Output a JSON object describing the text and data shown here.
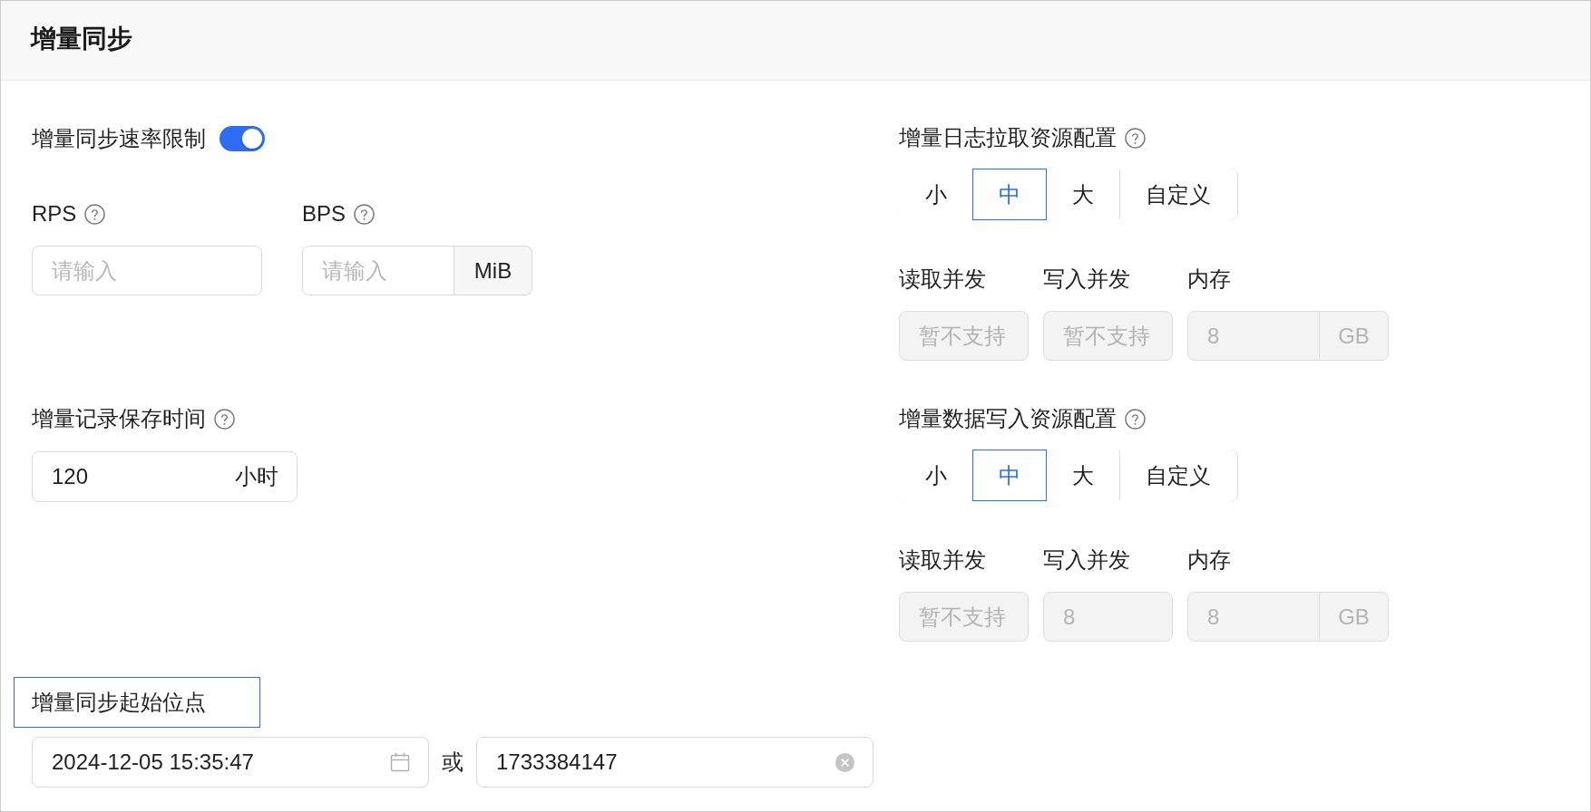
{
  "header": {
    "title": "增量同步"
  },
  "rate_limit": {
    "label": "增量同步速率限制",
    "on": true
  },
  "rate_fields": [
    {
      "label": "RPS",
      "help": true,
      "placeholder": "请输入",
      "disabled": false
    },
    {
      "label": "BPS",
      "help": true,
      "placeholder": "请输入",
      "unit": "MiB",
      "disabled": false
    }
  ],
  "retention": {
    "label": "增量记录保存时间",
    "help": true,
    "value": "120",
    "unit": "小时"
  },
  "start_position": {
    "label": "增量同步起始位点",
    "highlighted": true,
    "datetime": "2024-12-05 15:35:47",
    "separator": "或",
    "timestamp": "1733384147"
  },
  "resource_groups": [
    {
      "label": "增量日志拉取资源配置",
      "help": true,
      "options": [
        {
          "label": "小",
          "selected": false
        },
        {
          "label": "中",
          "selected": true
        },
        {
          "label": "大",
          "selected": false
        },
        {
          "label": "自定义",
          "selected": false
        }
      ],
      "fields": [
        {
          "label": "读取并发",
          "placeholder": "暂不支持",
          "disabled": true
        },
        {
          "label": "写入并发",
          "placeholder": "暂不支持",
          "disabled": true
        },
        {
          "label": "内存",
          "value": "8",
          "unit": "GB",
          "disabled": true
        }
      ]
    },
    {
      "label": "增量数据写入资源配置",
      "help": true,
      "options": [
        {
          "label": "小",
          "selected": false
        },
        {
          "label": "中",
          "selected": true
        },
        {
          "label": "大",
          "selected": false
        },
        {
          "label": "自定义",
          "selected": false
        }
      ],
      "fields": [
        {
          "label": "读取并发",
          "placeholder": "暂不支持",
          "disabled": true
        },
        {
          "label": "写入并发",
          "value": "8",
          "disabled": true
        },
        {
          "label": "内存",
          "value": "8",
          "unit": "GB",
          "disabled": true
        }
      ]
    }
  ]
}
